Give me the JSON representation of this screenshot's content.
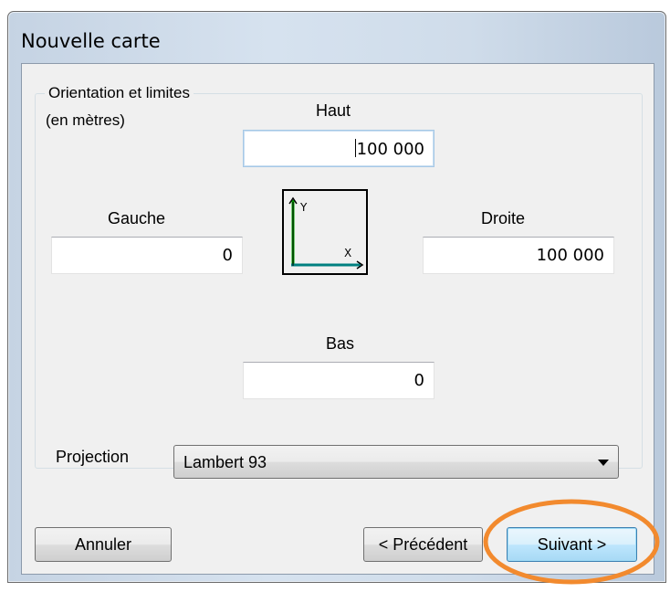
{
  "window": {
    "title": "Nouvelle carte"
  },
  "group": {
    "title": "Orientation et limites",
    "units": "(en mètres)"
  },
  "limits": {
    "top": {
      "label": "Haut",
      "value": "100 000"
    },
    "left": {
      "label": "Gauche",
      "value": "0"
    },
    "right": {
      "label": "Droite",
      "value": "100 000"
    },
    "bottom": {
      "label": "Bas",
      "value": "0"
    }
  },
  "axes": {
    "y_label": "Y",
    "x_label": "X",
    "y_color": "#00a000",
    "x_color": "#008080"
  },
  "projection": {
    "label": "Projection",
    "selected": "Lambert 93"
  },
  "buttons": {
    "cancel": "Annuler",
    "previous": "< Précédent",
    "next": "Suivant >"
  },
  "annotation": {
    "highlight_color": "#f28a2e"
  }
}
